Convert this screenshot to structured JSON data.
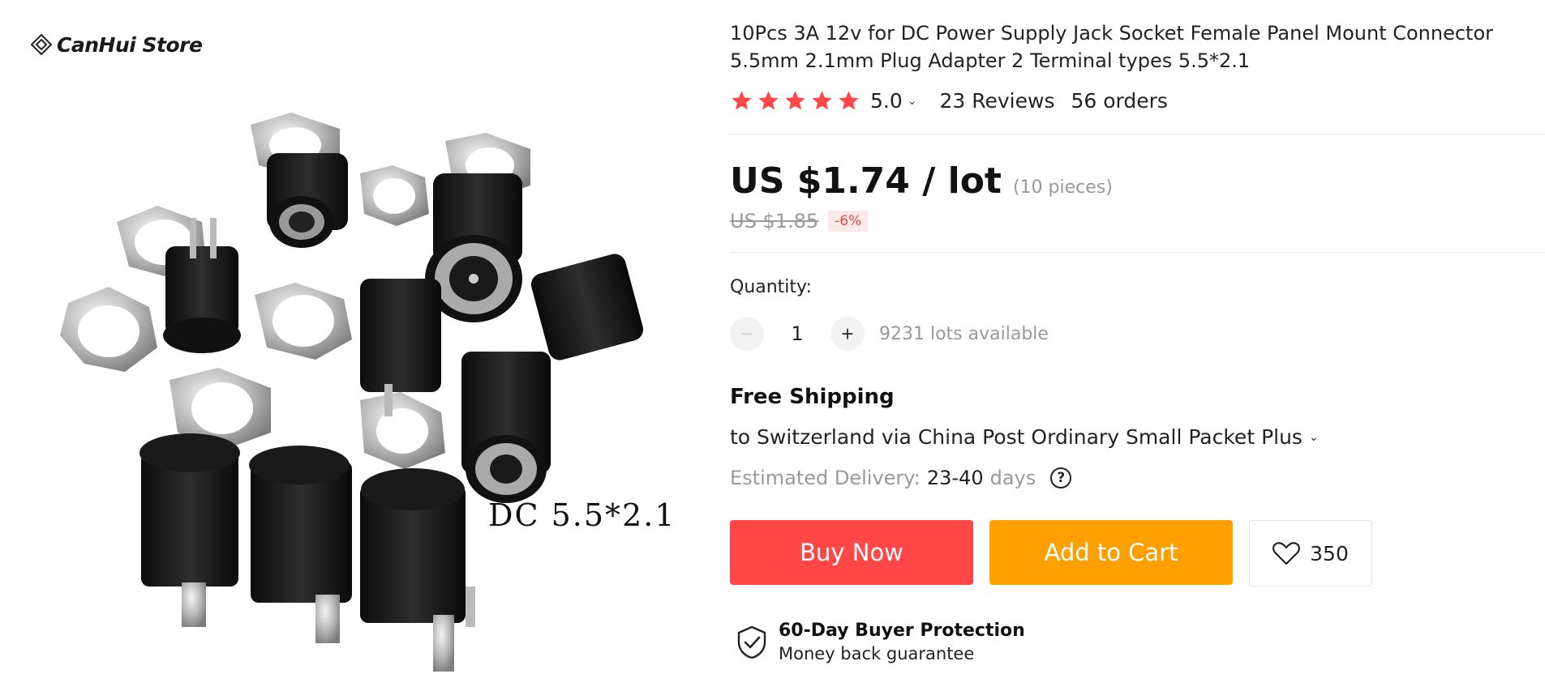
{
  "store": {
    "name": "CanHui Store"
  },
  "gallery": {
    "caption": "DC 5.5*2.1"
  },
  "product": {
    "title": "10Pcs 3A 12v for DC Power Supply Jack Socket Female Panel Mount Connector 5.5mm 2.1mm Plug Adapter 2 Terminal types 5.5*2.1",
    "rating": "5.0",
    "rating_stars": 5,
    "reviews": "23 Reviews",
    "orders": "56 orders",
    "star_color": "#ff4747"
  },
  "price": {
    "current": "US $1.74 / lot",
    "pieces": "(10 pieces)",
    "original": "US $1.85",
    "discount": "-6%"
  },
  "quantity": {
    "label": "Quantity:",
    "minus": "−",
    "plus": "+",
    "value": "1",
    "available": "9231 lots available"
  },
  "shipping": {
    "title": "Free Shipping",
    "destination": "to Switzerland via China Post Ordinary Small Packet Plus",
    "delivery_label": "Estimated Delivery:",
    "delivery_range": "23-40",
    "delivery_unit": "days",
    "help": "?"
  },
  "actions": {
    "buy_now": "Buy Now",
    "add_to_cart": "Add to Cart",
    "wishlist_count": "350",
    "buy_color": "#ff4747",
    "cart_color": "#ffa000"
  },
  "protection": {
    "title": "60-Day Buyer Protection",
    "subtitle": "Money back guarantee"
  },
  "icons": [
    "store-logo-icon",
    "star-icon",
    "chevron-down-icon",
    "question-icon",
    "heart-icon",
    "shield-check-icon"
  ]
}
